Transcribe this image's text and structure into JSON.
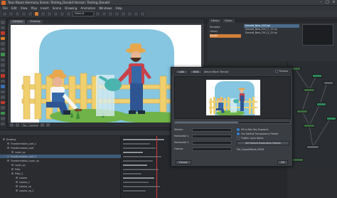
{
  "window": {
    "title": "Toon Boom Harmony Scene: Testing_Donald Version: Testing_Donald"
  },
  "menubar": {
    "items": [
      "File",
      "Edit",
      "View",
      "Play",
      "Insert",
      "Scene",
      "Drawing",
      "Animation",
      "Windows",
      "Help"
    ]
  },
  "toolbar": {
    "mode_value": "Default"
  },
  "camera_view": {
    "tabs": [
      "Camera",
      "Drawing"
    ],
    "footer_field": "Top / Camera-Harmony-Fit-Draw"
  },
  "library": {
    "tabs": [
      "Library",
      "Colour"
    ],
    "folders": [
      "Template",
      "Library",
      "Donald"
    ],
    "items": [
      "Donald_New_C00.tpl",
      "Donald_New_C00_2_12.tpl",
      "Donald_New_C00_3_12.tpl"
    ],
    "selected_index": 0
  },
  "dialog": {
    "tab_left": "LAB",
    "tab_right": "RGB",
    "title_label": "Album Black Text.tpl",
    "top_checkbox": "Preview",
    "progress": 0.55,
    "fields": [
      {
        "label": "Version",
        "value": ""
      },
      {
        "label": "Horizontal 1",
        "value": ""
      },
      {
        "label": "Horizontal 2",
        "value": ""
      },
      {
        "label": "Frames",
        "value": ""
      }
    ],
    "options": [
      {
        "label": "Fill to Max Key Exposure",
        "checked": true
      },
      {
        "label": "Use Default Transparency Modes",
        "checked": true
      },
      {
        "label": "Flatten Layer Name",
        "checked": false
      }
    ],
    "apply_button": "Set Default Destination Module",
    "destination_label": "File_Export/Movie_PDF.tf",
    "ok_button": "OK",
    "cancel_button": "Cancel"
  },
  "timeline": {
    "layers": [
      "Drawing",
      "Transformation_Leaf_2",
      "Transformation_Leaf",
      "Layer_up",
      "Transformation_Leaf_3",
      "Transformation_Layer_up",
      "Layer_up",
      "Pillar",
      "Pillar_2",
      "Leaves",
      "Leaves_2",
      "Leaves_up",
      "Leaves_up_2"
    ],
    "selected_index": 4
  },
  "colors": {
    "sky": "#86c6e0",
    "fence": "#f0cf6e",
    "grass": "#6fb349",
    "accent": "#d27e3a"
  }
}
